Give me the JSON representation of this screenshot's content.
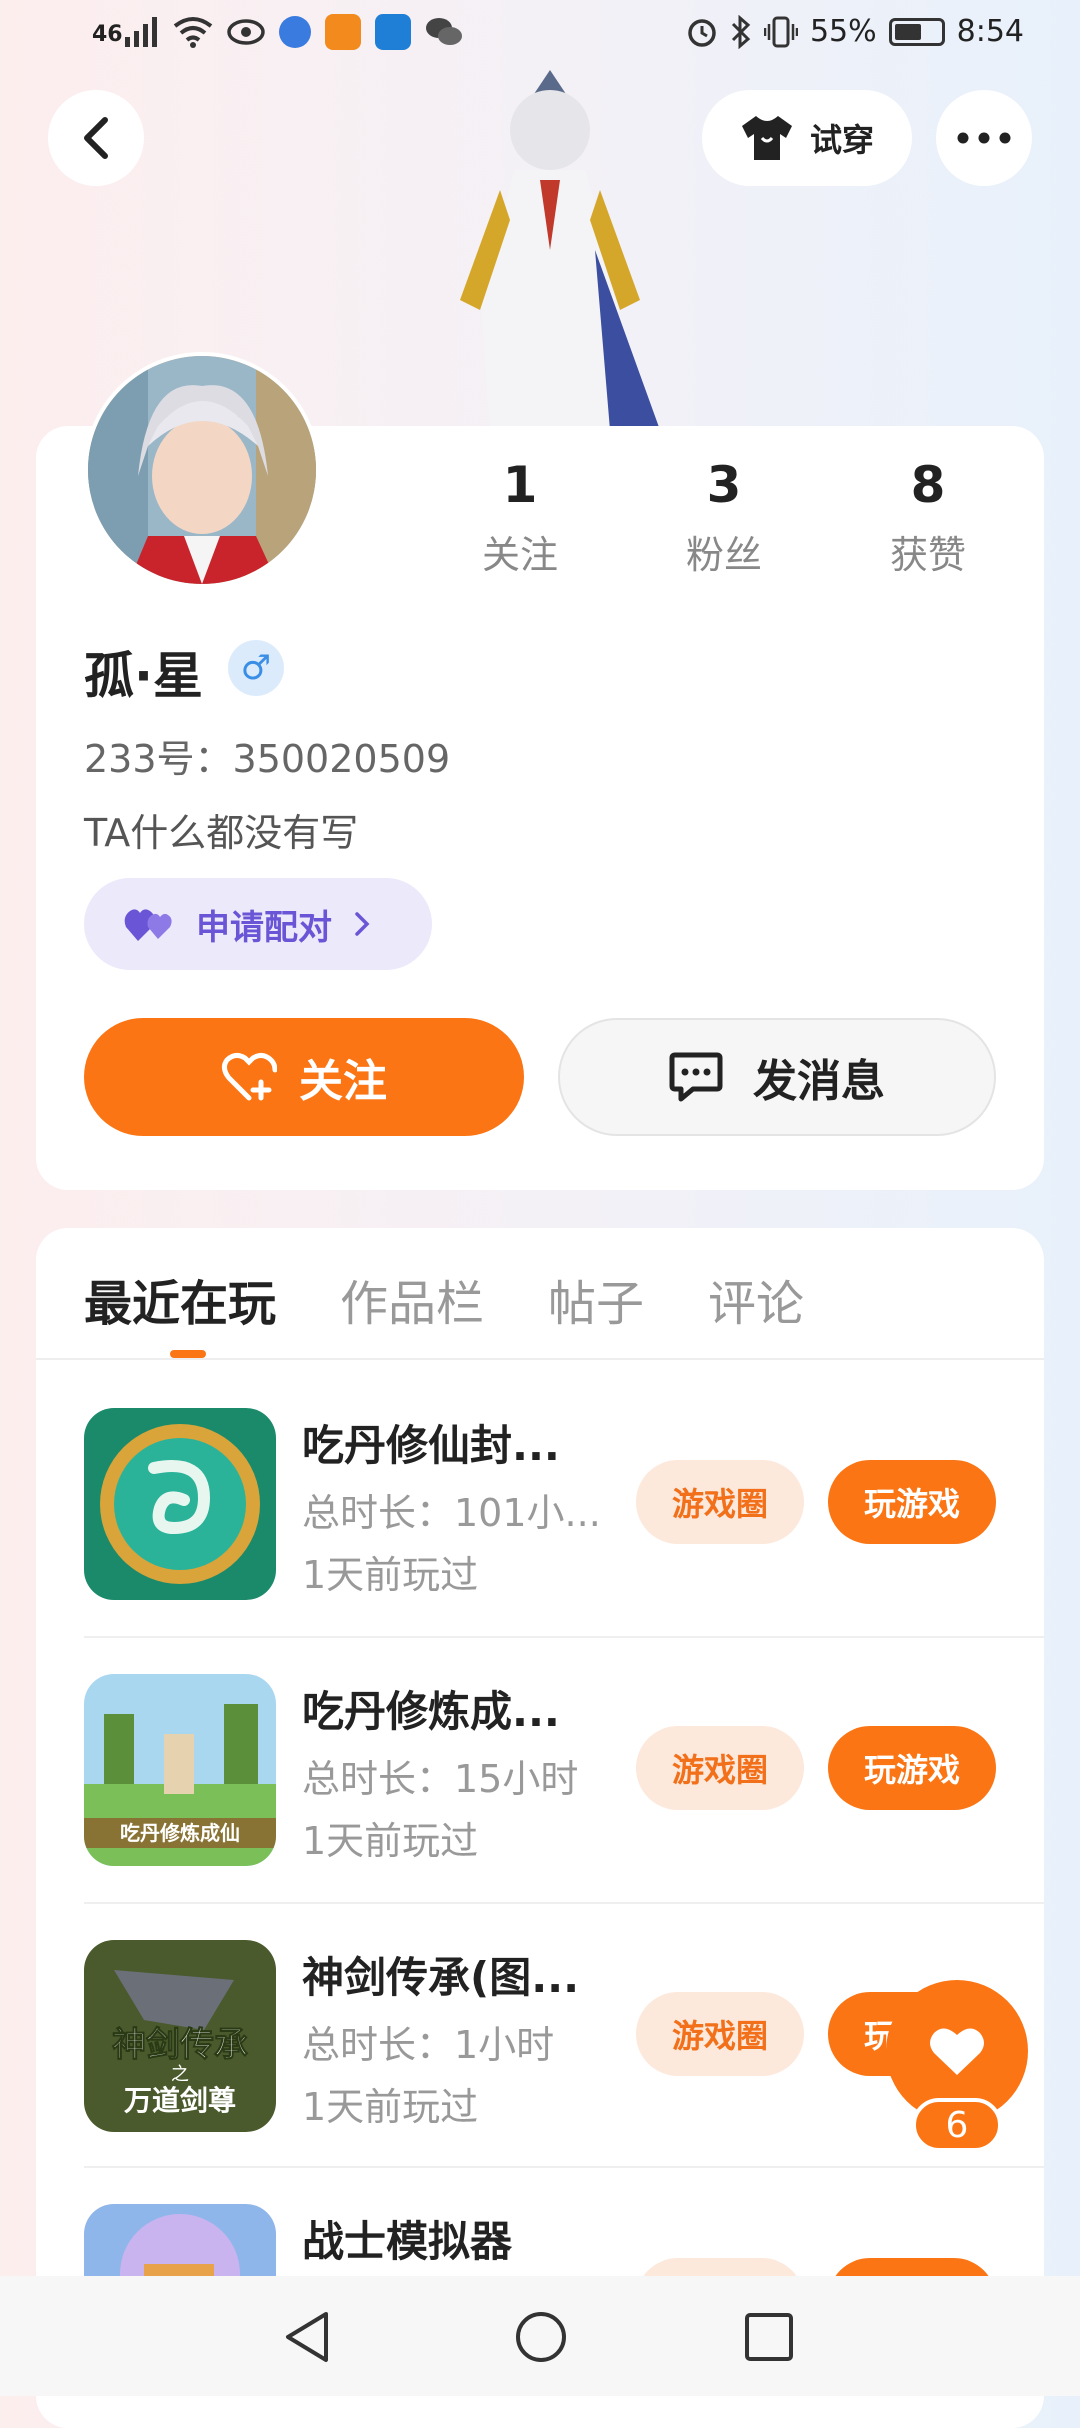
{
  "status_bar": {
    "signal": "46",
    "battery": "55%",
    "time": "8:54"
  },
  "header": {
    "tryon_label": "试穿"
  },
  "profile": {
    "stats": [
      {
        "num": "1",
        "label": "关注"
      },
      {
        "num": "3",
        "label": "粉丝"
      },
      {
        "num": "8",
        "label": "获赞"
      }
    ],
    "name": "孤·星",
    "gender_symbol": "♂",
    "id_text": "233号：350020509",
    "bio": "TA什么都没有写",
    "pair_label": "申请配对",
    "follow_label": "关注",
    "message_label": "发消息"
  },
  "tabs": [
    "最近在玩",
    "作品栏",
    "帖子",
    "评论"
  ],
  "games": [
    {
      "title": "吃丹修仙封...",
      "duration": "总时长：101小...",
      "last_played": "1天前玩过",
      "circle_label": "游戏圈",
      "play_label": "玩游戏"
    },
    {
      "title": "吃丹修炼成...",
      "duration": "总时长：15小时",
      "last_played": "1天前玩过",
      "circle_label": "游戏圈",
      "play_label": "玩游戏",
      "thumb_text": "吃丹修炼成仙"
    },
    {
      "title": "神剑传承(图...",
      "duration": "总时长：1小时",
      "last_played": "1天前玩过",
      "circle_label": "游戏圈",
      "play_label": "玩游戏",
      "thumb_text_top": "神剑传承",
      "thumb_text_mid": "之",
      "thumb_text_bottom": "万道剑尊"
    },
    {
      "title": "战士模拟器"
    }
  ],
  "like_count": "6",
  "colors": {
    "accent": "#fb7514",
    "pair_purple": "#6a55d6"
  }
}
